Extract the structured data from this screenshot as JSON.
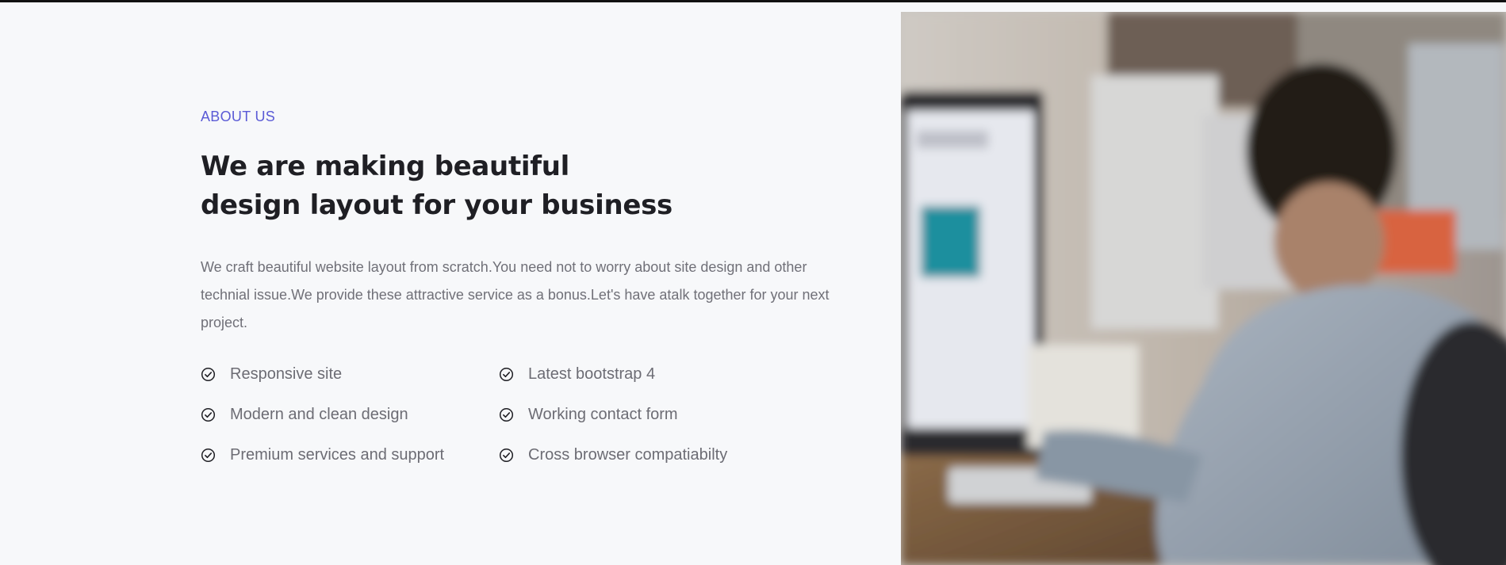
{
  "about": {
    "eyebrow": "ABOUT US",
    "heading_line1": "We are making beautiful",
    "heading_line2": "design layout for your business",
    "description": "We craft beautiful website layout from scratch.You need not to worry about site design and other technial issue.We provide these attractive service as a bonus.Let's have atalk together for your next project."
  },
  "features": {
    "items": [
      {
        "label": "Responsive site",
        "icon": "check-circle-icon"
      },
      {
        "label": "Latest bootstrap 4",
        "icon": "check-circle-icon"
      },
      {
        "label": "Modern and clean design",
        "icon": "check-circle-icon"
      },
      {
        "label": "Working contact form",
        "icon": "check-circle-icon"
      },
      {
        "label": "Premium services and support",
        "icon": "check-circle-icon"
      },
      {
        "label": "Cross browser compatiabilty",
        "icon": "check-circle-icon"
      }
    ]
  },
  "colors": {
    "accent": "#5b5bd6",
    "heading": "#1f1f24",
    "body_text": "#707078",
    "background": "#f7f8fa"
  }
}
